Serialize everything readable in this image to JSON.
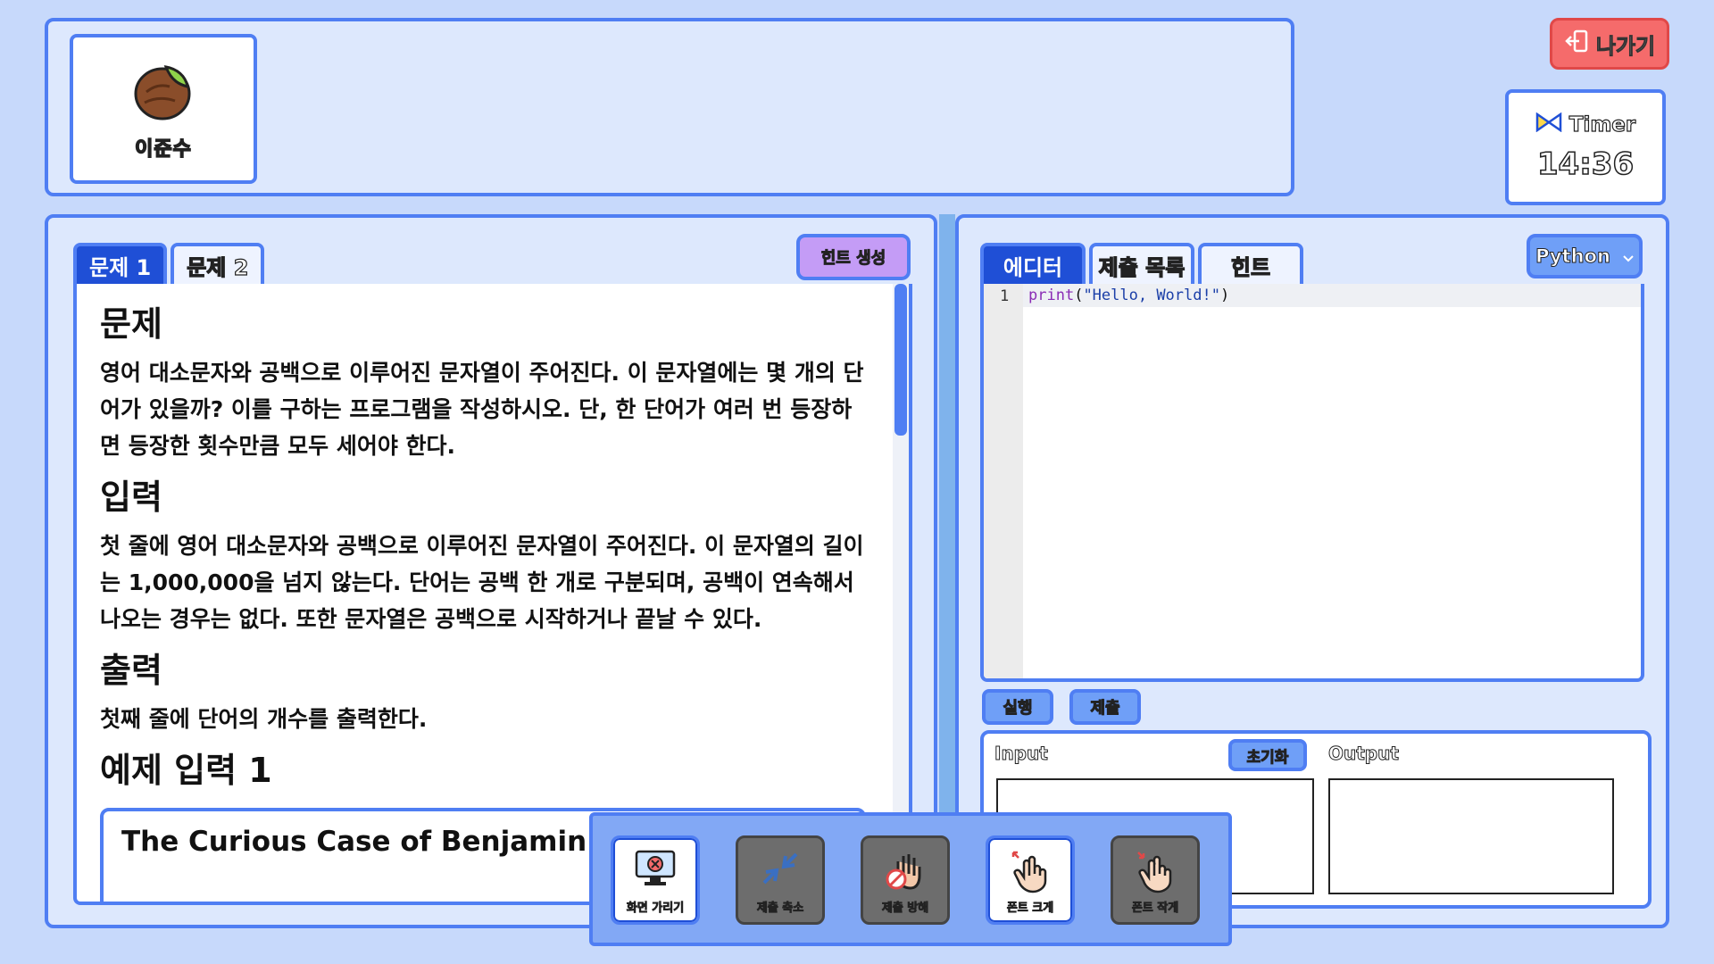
{
  "player": {
    "name": "이준수"
  },
  "exit_label": "나가기",
  "timer": {
    "label": "Timer",
    "value": "14:36"
  },
  "problem_tabs": [
    "문제 1",
    "문제 2"
  ],
  "hint_generate_label": "힌트 생성",
  "problem": {
    "heading_problem": "문제",
    "body_problem": "영어 대소문자와 공백으로 이루어진 문자열이 주어진다. 이 문자열에는 몇 개의 단어가 있을까? 이를 구하는 프로그램을 작성하시오. 단, 한 단어가 여러 번 등장하면 등장한 횟수만큼 모두 세어야 한다.",
    "heading_input": "입력",
    "body_input": "첫 줄에 영어 대소문자와 공백으로 이루어진 문자열이 주어진다. 이 문자열의 길이는 1,000,000을 넘지 않는다. 단어는 공백 한 개로 구분되며, 공백이 연속해서 나오는 경우는 없다. 또한 문자열은 공백으로 시작하거나 끝날 수 있다.",
    "heading_output": "출력",
    "body_output": "첫째 줄에 단어의 개수를 출력한다.",
    "heading_example": "예제 입력 1",
    "example_input": "The Curious Case of Benjamin Button"
  },
  "editor_tabs": [
    "에디터",
    "제출 목록",
    "힌트"
  ],
  "language": "Python",
  "code": {
    "line_number": "1",
    "func": "print",
    "open": "(",
    "string": "\"Hello, World!\"",
    "close": ")"
  },
  "run_label": "실행",
  "submit_label": "제출",
  "io": {
    "input_label": "Input",
    "reset_label": "초기화",
    "output_label": "Output"
  },
  "items": [
    {
      "label": "화면 가리기",
      "icon": "monitor-blocked-icon",
      "enabled": true
    },
    {
      "label": "제출 축소",
      "icon": "shrink-arrows-icon",
      "enabled": false
    },
    {
      "label": "제출 방해",
      "icon": "blocked-hand-icon",
      "enabled": false
    },
    {
      "label": "폰트 크게",
      "icon": "hand-expand-icon",
      "enabled": true
    },
    {
      "label": "폰트 작게",
      "icon": "hand-shrink-icon",
      "enabled": false
    }
  ],
  "colors": {
    "background": "#c7d9fb",
    "panel": "#dde8fd",
    "accent_border": "#4f7ef3",
    "active_tab": "#1f4fd6",
    "exit_button": "#f56b6b",
    "hint_button": "#c49cf6"
  }
}
